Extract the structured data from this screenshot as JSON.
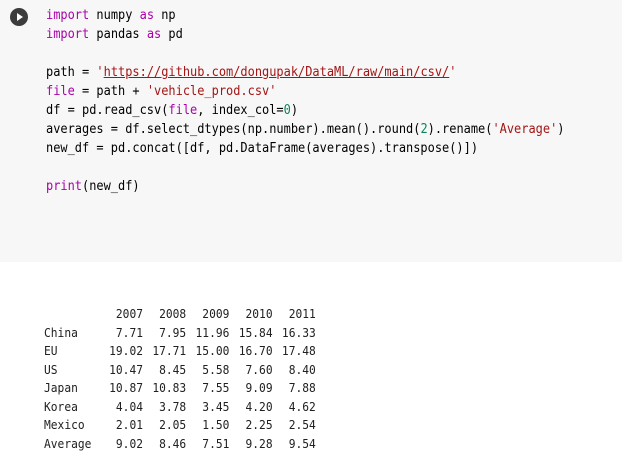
{
  "code": {
    "lines": [
      [
        {
          "t": "import",
          "c": "kw"
        },
        {
          "t": " numpy ",
          "c": ""
        },
        {
          "t": "as",
          "c": "kw"
        },
        {
          "t": " np",
          "c": ""
        }
      ],
      [
        {
          "t": "import",
          "c": "kw"
        },
        {
          "t": " pandas ",
          "c": ""
        },
        {
          "t": "as",
          "c": "kw"
        },
        {
          "t": " pd",
          "c": ""
        }
      ],
      [],
      [
        {
          "t": "path = ",
          "c": ""
        },
        {
          "t": "'",
          "c": "str"
        },
        {
          "t": "https://github.com/dongupak/DataML/raw/main/csv/",
          "c": "url"
        },
        {
          "t": "'",
          "c": "str"
        }
      ],
      [
        {
          "t": "file",
          "c": "kw"
        },
        {
          "t": " = path + ",
          "c": ""
        },
        {
          "t": "'vehicle_prod.csv'",
          "c": "str"
        }
      ],
      [
        {
          "t": "df = pd.read_csv(",
          "c": ""
        },
        {
          "t": "file",
          "c": "kw"
        },
        {
          "t": ", index_col=",
          "c": ""
        },
        {
          "t": "0",
          "c": "num"
        },
        {
          "t": ")",
          "c": ""
        }
      ],
      [
        {
          "t": "averages = df.select_dtypes(np.number).mean().round(",
          "c": ""
        },
        {
          "t": "2",
          "c": "num"
        },
        {
          "t": ").rename(",
          "c": ""
        },
        {
          "t": "'Average'",
          "c": "str"
        },
        {
          "t": ")",
          "c": ""
        }
      ],
      [
        {
          "t": "new_df = pd.concat([df, pd.DataFrame(averages).transpose()])",
          "c": ""
        }
      ],
      [],
      [
        {
          "t": "print",
          "c": "kw"
        },
        {
          "t": "(new_df)",
          "c": ""
        }
      ]
    ]
  },
  "output": {
    "columns": [
      "2007",
      "2008",
      "2009",
      "2010",
      "2011"
    ],
    "rows": [
      {
        "index": "China",
        "values": [
          "7.71",
          "7.95",
          "11.96",
          "15.84",
          "16.33"
        ]
      },
      {
        "index": "EU",
        "values": [
          "19.02",
          "17.71",
          "15.00",
          "16.70",
          "17.48"
        ]
      },
      {
        "index": "US",
        "values": [
          "10.47",
          "8.45",
          "5.58",
          "7.60",
          "8.40"
        ]
      },
      {
        "index": "Japan",
        "values": [
          "10.87",
          "10.83",
          "7.55",
          "9.09",
          "7.88"
        ]
      },
      {
        "index": "Korea",
        "values": [
          "4.04",
          "3.78",
          "3.45",
          "4.20",
          "4.62"
        ]
      },
      {
        "index": "Mexico",
        "values": [
          "2.01",
          "2.05",
          "1.50",
          "2.25",
          "2.54"
        ]
      },
      {
        "index": "Average",
        "values": [
          "9.02",
          "8.46",
          "7.51",
          "9.28",
          "9.54"
        ]
      }
    ]
  },
  "icons": {
    "run": "play-circle-icon"
  }
}
